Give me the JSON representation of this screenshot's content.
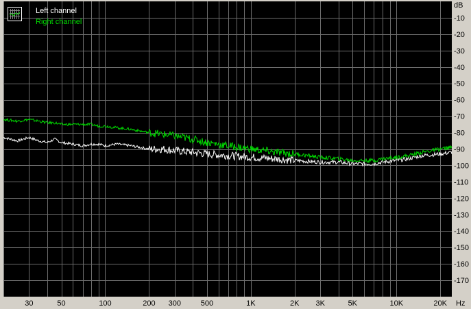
{
  "chart_data": {
    "type": "line",
    "title": "",
    "xlabel": "Hz",
    "ylabel": "dB",
    "x_scale": "log",
    "xlim": [
      20,
      24000
    ],
    "ylim": [
      -180,
      0
    ],
    "grid": true,
    "legend_position": "top-left",
    "x_ticks": [
      {
        "value": 30,
        "label": "30"
      },
      {
        "value": 50,
        "label": "50"
      },
      {
        "value": 100,
        "label": "100"
      },
      {
        "value": 200,
        "label": "200"
      },
      {
        "value": 300,
        "label": "300"
      },
      {
        "value": 500,
        "label": "500"
      },
      {
        "value": 1000,
        "label": "1K"
      },
      {
        "value": 2000,
        "label": "2K"
      },
      {
        "value": 3000,
        "label": "3K"
      },
      {
        "value": 5000,
        "label": "5K"
      },
      {
        "value": 10000,
        "label": "10K"
      },
      {
        "value": 20000,
        "label": "20K"
      }
    ],
    "y_ticks": [
      {
        "value": -10,
        "label": "-10"
      },
      {
        "value": -20,
        "label": "-20"
      },
      {
        "value": -30,
        "label": "-30"
      },
      {
        "value": -40,
        "label": "-40"
      },
      {
        "value": -50,
        "label": "-50"
      },
      {
        "value": -60,
        "label": "-60"
      },
      {
        "value": -70,
        "label": "-70"
      },
      {
        "value": -80,
        "label": "-80"
      },
      {
        "value": -90,
        "label": "-90"
      },
      {
        "value": -100,
        "label": "-100"
      },
      {
        "value": -110,
        "label": "-110"
      },
      {
        "value": -120,
        "label": "-120"
      },
      {
        "value": -130,
        "label": "-130"
      },
      {
        "value": -140,
        "label": "-140"
      },
      {
        "value": -150,
        "label": "-150"
      },
      {
        "value": -160,
        "label": "-160"
      },
      {
        "value": -170,
        "label": "-170"
      }
    ],
    "series": [
      {
        "name": "Left channel",
        "color": "#ffffff",
        "x": [
          20,
          25,
          30,
          35,
          40,
          45,
          50,
          60,
          70,
          80,
          90,
          100,
          120,
          150,
          200,
          250,
          300,
          400,
          500,
          700,
          1000,
          1500,
          2000,
          3000,
          4000,
          5000,
          6000,
          7000,
          8000,
          10000,
          12000,
          15000,
          20000,
          24000
        ],
        "y": [
          -83,
          -85,
          -83,
          -85,
          -86,
          -84,
          -86,
          -87,
          -88,
          -87,
          -87,
          -88,
          -87,
          -88,
          -90,
          -90,
          -91,
          -92,
          -93,
          -94,
          -95,
          -96,
          -97,
          -98,
          -98,
          -99,
          -99,
          -99,
          -98,
          -97,
          -96,
          -94,
          -93,
          -92
        ]
      },
      {
        "name": "Right channel",
        "color": "#00dd00",
        "x": [
          20,
          25,
          30,
          35,
          40,
          45,
          50,
          60,
          70,
          80,
          90,
          100,
          120,
          150,
          200,
          250,
          300,
          400,
          500,
          700,
          1000,
          1500,
          2000,
          3000,
          4000,
          5000,
          6000,
          7000,
          8000,
          10000,
          12000,
          15000,
          20000,
          24000
        ],
        "y": [
          -72,
          -73,
          -72,
          -73,
          -74,
          -74,
          -75,
          -75,
          -75,
          -75,
          -76,
          -76,
          -77,
          -78,
          -80,
          -81,
          -82,
          -84,
          -86,
          -88,
          -90,
          -92,
          -93,
          -95,
          -96,
          -97,
          -97,
          -97,
          -96,
          -95,
          -94,
          -92,
          -90,
          -89
        ]
      }
    ]
  }
}
